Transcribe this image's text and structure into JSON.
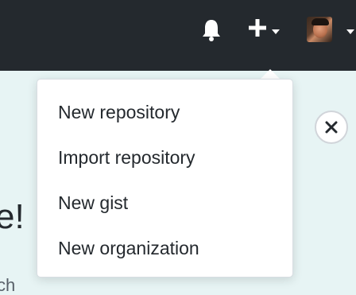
{
  "header": {
    "icons": {
      "notifications": "bell-icon",
      "create": "plus-icon",
      "create_caret": "caret-down-icon",
      "profile_caret": "caret-down-icon"
    },
    "colors": {
      "bar": "#24292e",
      "icon": "#ffffff"
    }
  },
  "create_menu": {
    "items": [
      {
        "label": "New repository"
      },
      {
        "label": "Import repository"
      },
      {
        "label": "New gist"
      },
      {
        "label": "New organization"
      }
    ]
  },
  "background": {
    "heading_fragment": "e!",
    "subtext_fragment": "ch",
    "color": "#e7f4f4"
  },
  "dismiss": {
    "icon": "close-icon"
  }
}
